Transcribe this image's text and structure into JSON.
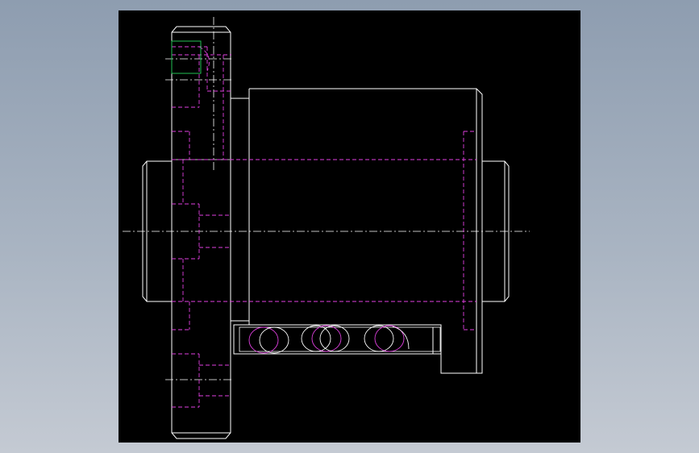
{
  "viewer": {
    "background_color": "#000000",
    "backdrop_gradient": [
      "#8e9db0",
      "#c4cad3"
    ]
  },
  "drawing": {
    "line_colors": {
      "visible_edge": "#ffffff",
      "hidden_line": "#e040e0",
      "highlight_box": "#22c055"
    }
  }
}
